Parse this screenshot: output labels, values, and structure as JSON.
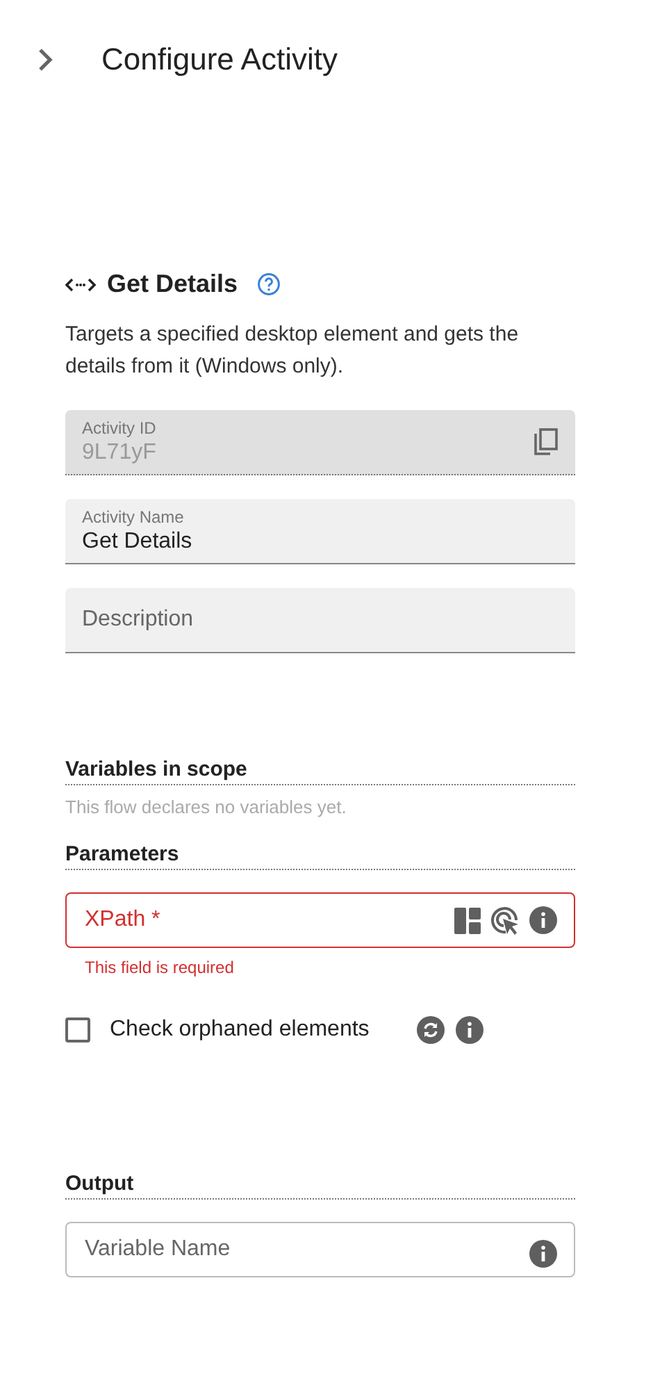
{
  "header": {
    "title": "Configure Activity"
  },
  "activity": {
    "name": "Get Details",
    "description": "Targets a specified desktop element and gets the details from it (Windows only)."
  },
  "fields": [
    {
      "kind": "readonly",
      "label": "Activity ID",
      "value": "9L71yF"
    },
    {
      "kind": "filled",
      "label": "Activity Name",
      "value": "Get Details"
    },
    {
      "kind": "filled",
      "placeholder": "Description"
    }
  ],
  "variables": {
    "heading": "Variables in scope",
    "empty_text": "This flow declares no variables yet."
  },
  "parameters": {
    "heading": "Parameters",
    "xpath": {
      "label": "XPath *",
      "invalid": true,
      "error": "This field is required"
    },
    "checkbox": {
      "label": "Check orphaned elements",
      "checked": false
    }
  },
  "output": {
    "heading": "Output",
    "field": {
      "placeholder": "Variable Name"
    }
  }
}
